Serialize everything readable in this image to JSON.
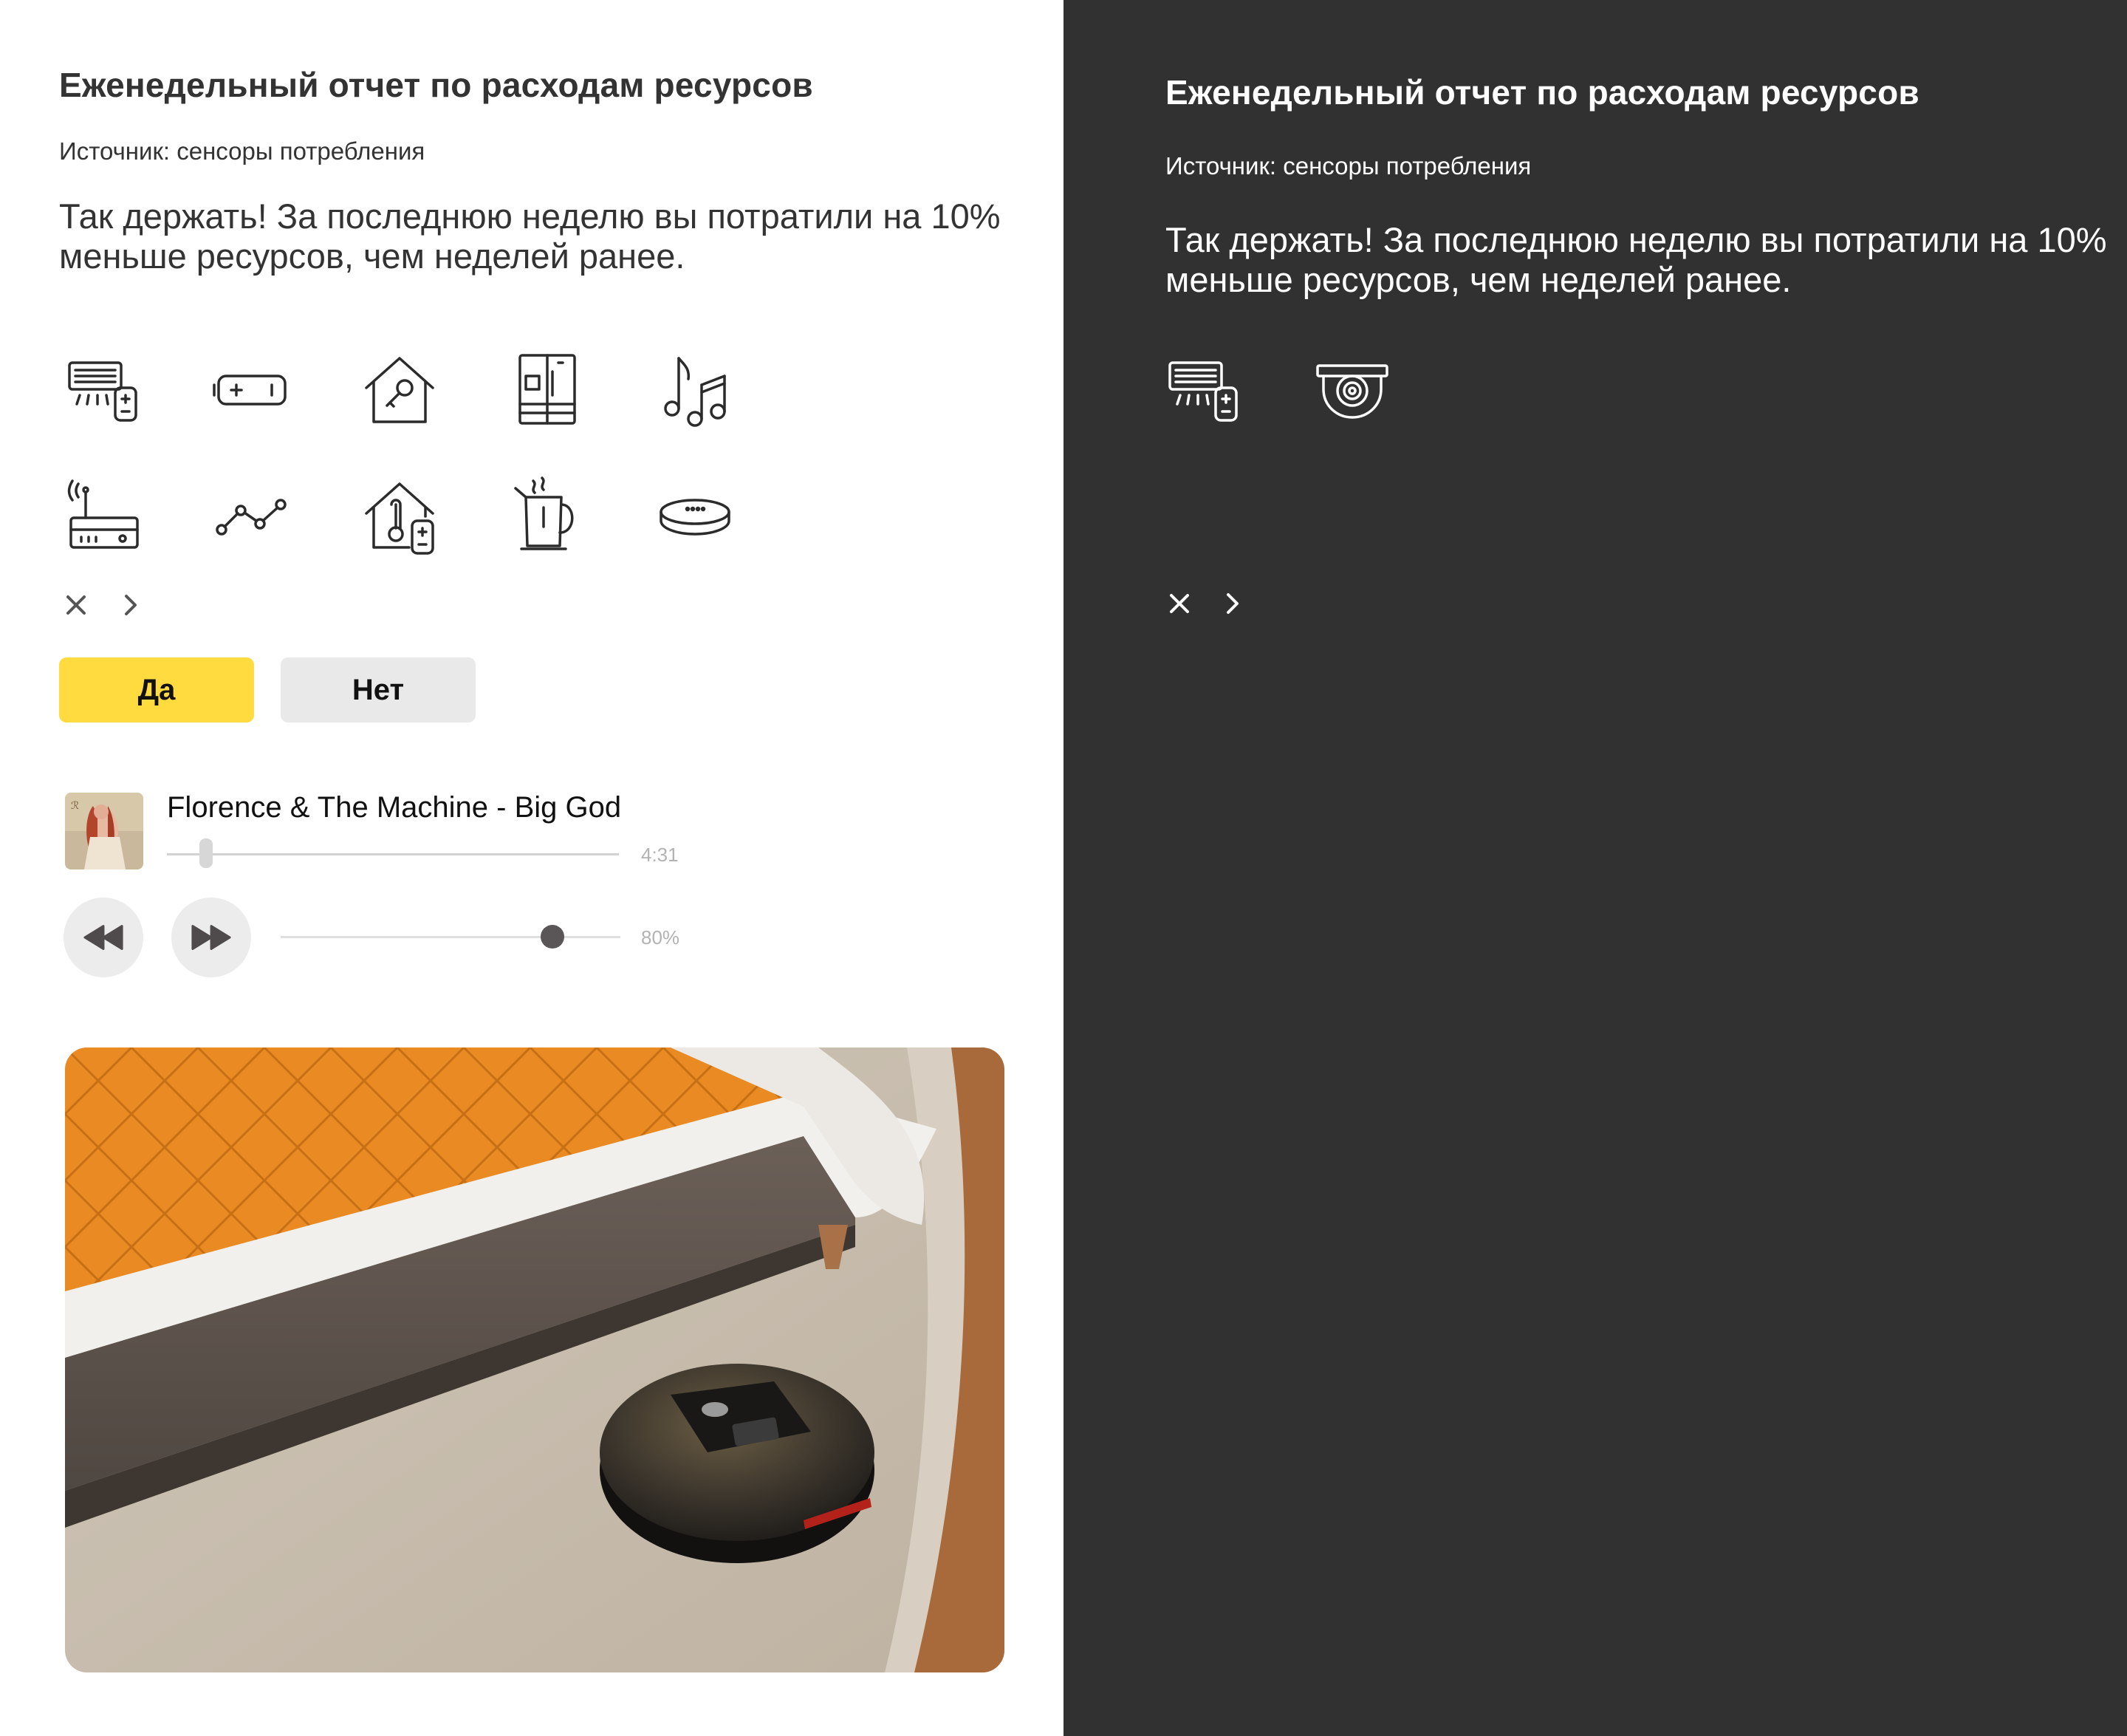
{
  "light_card": {
    "title": "Еженедельный отчет по расходам ресурсов",
    "source": "Источник: сенсоры потребления",
    "message": "Так держать! За последнюю неделю вы потратили на 10% меньше ресурсов, чем неделей ранее.",
    "icons": [
      "ac-remote-icon",
      "battery-icon",
      "smart-home-key-icon",
      "fridge-icon",
      "music-notes-icon",
      "router-icon",
      "chart-line-icon",
      "home-thermometer-icon",
      "kettle-icon",
      "smart-speaker-icon"
    ],
    "nav": {
      "close": "close-icon",
      "next": "chevron-right-icon"
    },
    "buttons": {
      "yes": "Да",
      "no": "Нет"
    },
    "player": {
      "track": "Florence & The Machine - Big God",
      "duration": "4:31",
      "progress_fraction": 0.08,
      "volume_percent": 80,
      "volume_label": "80%"
    }
  },
  "dark_card": {
    "title": "Еженедельный отчет по расходам ресурсов",
    "source": "Источник: сенсоры потребления",
    "message": "Так держать! За последнюю неделю вы потратили на 10% меньше ресурсов, чем неделей ранее.",
    "icons": [
      "ac-remote-icon",
      "security-camera-icon"
    ],
    "nav": {
      "close": "close-icon",
      "next": "chevron-right-icon"
    }
  },
  "colors": {
    "yes_button": "#ffdb3f",
    "no_button": "#e9e9e9",
    "dark_background": "#313131",
    "light_text": "#333333",
    "dark_text": "#ffffff"
  }
}
